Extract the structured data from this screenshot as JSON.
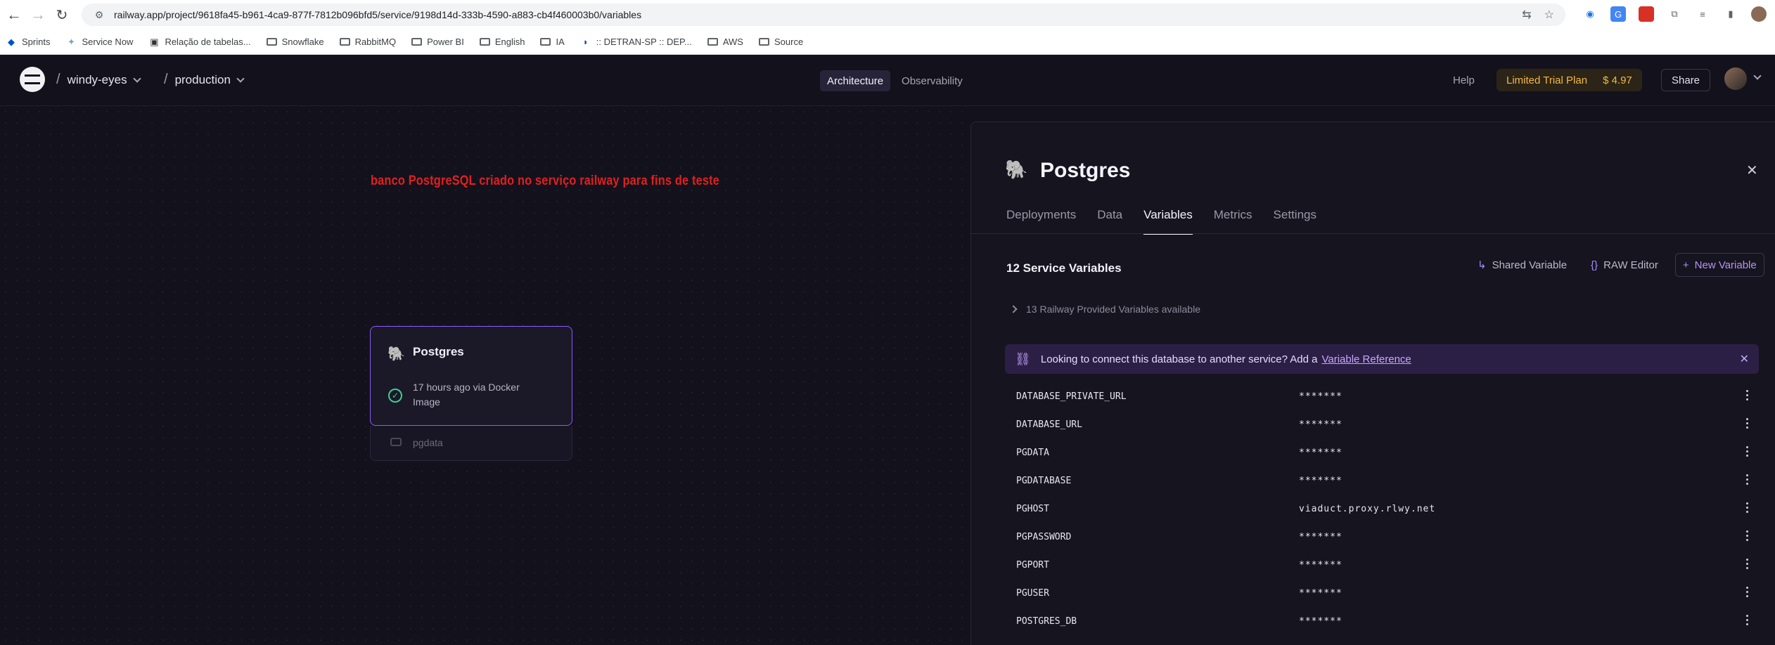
{
  "browser": {
    "url": "railway.app/project/9618fa45-b961-4ca9-877f-7812b096bfd5/service/9198d14d-333b-4590-a883-cb4f460003b0/variables",
    "bookmarks": [
      "Sprints",
      "Service Now",
      "Relação de tabelas...",
      "Snowflake",
      "RabbitMQ",
      "Power BI",
      "English",
      "IA",
      ":: DETRAN-SP :: DEP...",
      "AWS",
      "Source"
    ]
  },
  "header": {
    "project": "windy-eyes",
    "environment": "production",
    "tabs": [
      "Architecture",
      "Observability"
    ],
    "help": "Help",
    "trial_label": "Limited Trial Plan",
    "trial_amount": "$ 4.97",
    "share": "Share"
  },
  "canvas": {
    "annotation": "banco PostgreSQL criado no serviço railway para fins de teste",
    "service": {
      "name": "Postgres",
      "status": "17 hours ago via Docker Image",
      "volume": "pgdata"
    }
  },
  "panel": {
    "title": "Postgres",
    "tabs": [
      "Deployments",
      "Data",
      "Variables",
      "Metrics",
      "Settings"
    ],
    "vars_title": "12 Service Variables",
    "buttons": {
      "shared": "Shared Variable",
      "raw": "RAW Editor",
      "new": "New Variable"
    },
    "provided": "13 Railway Provided Variables available",
    "banner_text": "Looking to connect this database to another service? Add a",
    "banner_link": "Variable Reference",
    "variables": [
      {
        "key": "DATABASE_PRIVATE_URL",
        "value": "*******"
      },
      {
        "key": "DATABASE_URL",
        "value": "*******"
      },
      {
        "key": "PGDATA",
        "value": "*******"
      },
      {
        "key": "PGDATABASE",
        "value": "*******"
      },
      {
        "key": "PGHOST",
        "value": "viaduct.proxy.rlwy.net"
      },
      {
        "key": "PGPASSWORD",
        "value": "*******"
      },
      {
        "key": "PGPORT",
        "value": "*******"
      },
      {
        "key": "PGUSER",
        "value": "*******"
      },
      {
        "key": "POSTGRES_DB",
        "value": "*******"
      }
    ]
  },
  "colors": {
    "accent": "#8b5cf6",
    "trial": "#f4b942",
    "annotation": "#e0201f",
    "ok": "#3ecf8e"
  }
}
